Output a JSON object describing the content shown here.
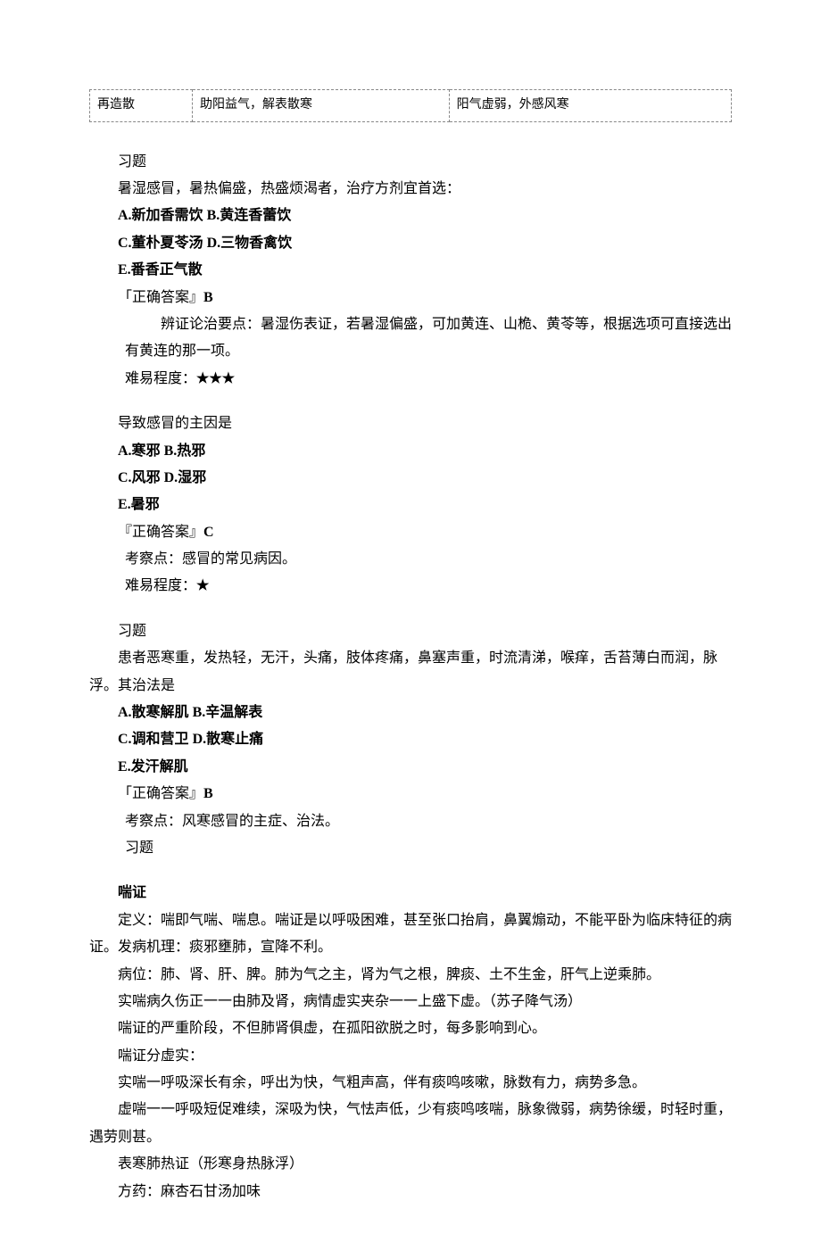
{
  "table": {
    "c1": "再造散",
    "c2": "助阳益气，解表散寒",
    "c3": "阳气虚弱，外感风寒"
  },
  "q1": {
    "header": "习题",
    "stem": "暑湿感冒，暑热偏盛，热盛烦渴者，治疗方剂宜首选：",
    "optA": "A.新加香需饮 ",
    "optB": "B.黄连香蕾饮",
    "optC": "C.董朴夏苓汤 ",
    "optD": "D.三物香禽饮",
    "optE": "E.番香正气散",
    "answer_label": "「正确答案』",
    "answer_value": "B",
    "analysis": "辨证论治要点：暑湿伤表证，若暑湿偏盛，可加黄连、山桅、黄苓等，根据选项可直接选出有黄连的那一项。",
    "difficulty_label": "难易程度：",
    "difficulty_value": "★★★"
  },
  "q2": {
    "stem": "导致感冒的主因是",
    "optA": "A.寒邪 ",
    "optB": "B.热邪",
    "optC": "C.风邪 ",
    "optD": "D.湿邪",
    "optE": "E.暑邪",
    "answer_label": "『正确答案』",
    "answer_value": "C",
    "analysis": "考察点：感冒的常见病因。",
    "difficulty_label": "难易程度：",
    "difficulty_value": "★"
  },
  "q3": {
    "header": "习题",
    "stem": "患者恶寒重，发热轻，无汗，头痛，肢体疼痛，鼻塞声重，时流清涕，喉痒，舌苔薄白而润，脉浮。其治法是",
    "optA": "A.散寒解肌 ",
    "optB": "B.辛温解表",
    "optC": "C.调和营卫 ",
    "optD": "D.散寒止痛",
    "optE": "E.发汗解肌",
    "answer_label": "「正确答案』",
    "answer_value": "B",
    "analysis": "考察点：风寒感冒的主症、治法。",
    "footer": "习题"
  },
  "chuan": {
    "title": "喘证",
    "p1": "定义：喘即气喘、喘息。喘证是以呼吸困难，甚至张口抬肩，鼻翼煽动，不能平卧为临床特征的病证。发病机理：痰邪壅肺，宣降不利。",
    "p2": "病位：肺、肾、肝、脾。肺为气之主，肾为气之根，脾痰、土不生金，肝气上逆乘肺。",
    "p3": "实喘病久伤正一一由肺及肾，病情虚实夹杂一一上盛下虚。（苏子降气汤）",
    "p4": "喘证的严重阶段，不但肺肾俱虚，在孤阳欲脱之时，每多影响到心。",
    "p5": "喘证分虚实：",
    "p6": "实喘一呼吸深长有余，呼出为快，气粗声高，伴有痰鸣咳嗽，脉数有力，病势多急。",
    "p7": "虚喘一一呼吸短促难续，深吸为快，气怯声低，少有痰鸣咳喘，脉象微弱，病势徐缓，时轻时重，遇劳则甚。",
    "p8": "表寒肺热证（形寒身热脉浮）",
    "p9": "方药：麻杏石甘汤加味"
  }
}
